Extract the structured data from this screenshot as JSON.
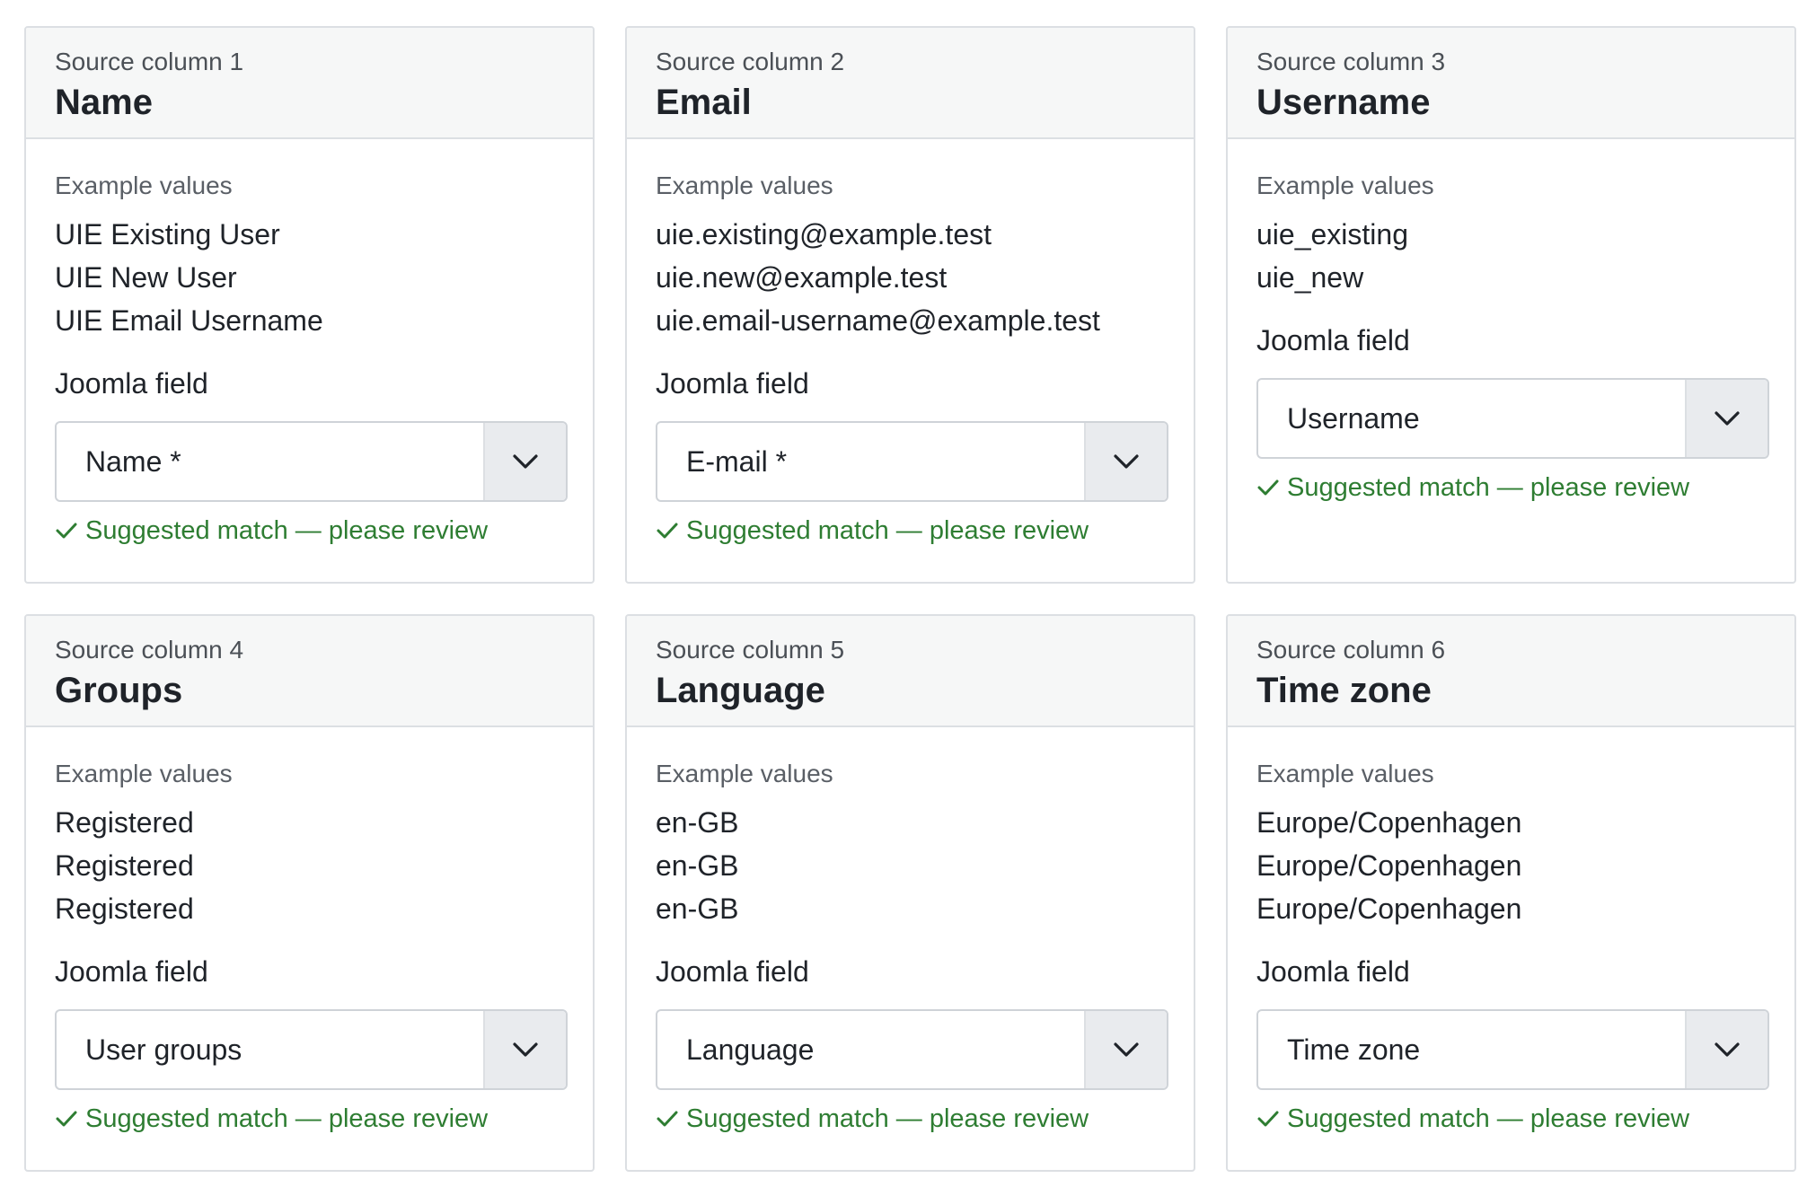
{
  "common": {
    "example_label": "Example values",
    "field_label": "Joomla field",
    "hint_text": "Suggested match — please review",
    "hint_color": "#2e7d32"
  },
  "columns": [
    {
      "source_label": "Source column 1",
      "title": "Name",
      "examples": [
        "UIE Existing User",
        "UIE New User",
        "UIE Email Username"
      ],
      "selected": "Name *"
    },
    {
      "source_label": "Source column 2",
      "title": "Email",
      "examples": [
        "uie.existing@example.test",
        "uie.new@example.test",
        "uie.email-username@example.test"
      ],
      "selected": "E-mail *"
    },
    {
      "source_label": "Source column 3",
      "title": "Username",
      "examples": [
        "uie_existing",
        "uie_new"
      ],
      "selected": "Username"
    },
    {
      "source_label": "Source column 4",
      "title": "Groups",
      "examples": [
        "Registered",
        "Registered",
        "Registered"
      ],
      "selected": "User groups"
    },
    {
      "source_label": "Source column 5",
      "title": "Language",
      "examples": [
        "en-GB",
        "en-GB",
        "en-GB"
      ],
      "selected": "Language"
    },
    {
      "source_label": "Source column 6",
      "title": "Time zone",
      "examples": [
        "Europe/Copenhagen",
        "Europe/Copenhagen",
        "Europe/Copenhagen"
      ],
      "selected": "Time zone"
    }
  ]
}
